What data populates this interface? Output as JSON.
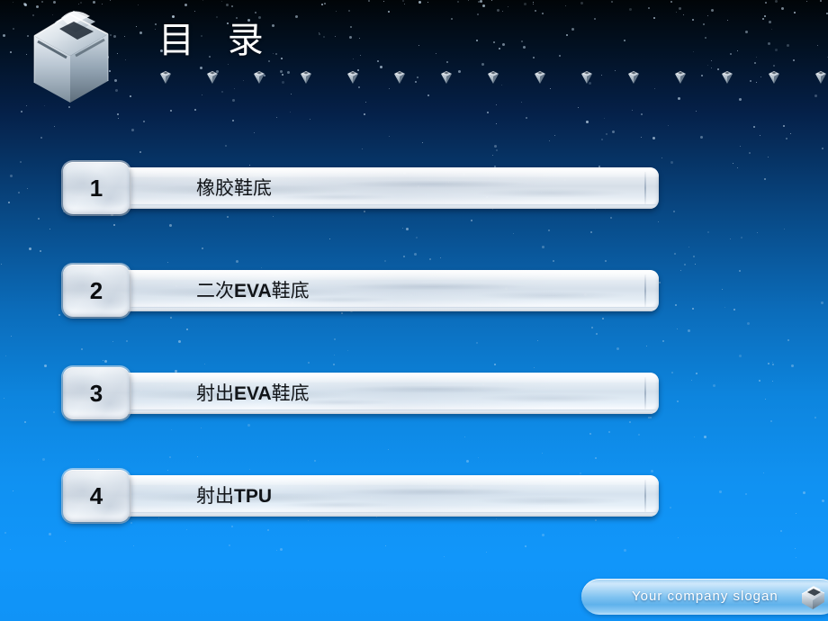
{
  "slide": {
    "title": "目 录",
    "logo_icon": "metallic-cube-icon",
    "background_top_color": "#010508",
    "background_bottom_color": "#1093f7"
  },
  "decor": {
    "gem_icon": "gem-icon",
    "gem_count": 15
  },
  "agenda": {
    "items": [
      {
        "number": "1",
        "label_prefix": "橡胶鞋底",
        "label_bold": "",
        "label_suffix": ""
      },
      {
        "number": "2",
        "label_prefix": "二次",
        "label_bold": "EVA",
        "label_suffix": "鞋底"
      },
      {
        "number": "3",
        "label_prefix": "射出",
        "label_bold": "EVA",
        "label_suffix": "鞋底"
      },
      {
        "number": "4",
        "label_prefix": "射出",
        "label_bold": "TPU",
        "label_suffix": ""
      }
    ]
  },
  "footer": {
    "slogan": "Your company slogan",
    "cube_icon": "metallic-cube-icon"
  }
}
